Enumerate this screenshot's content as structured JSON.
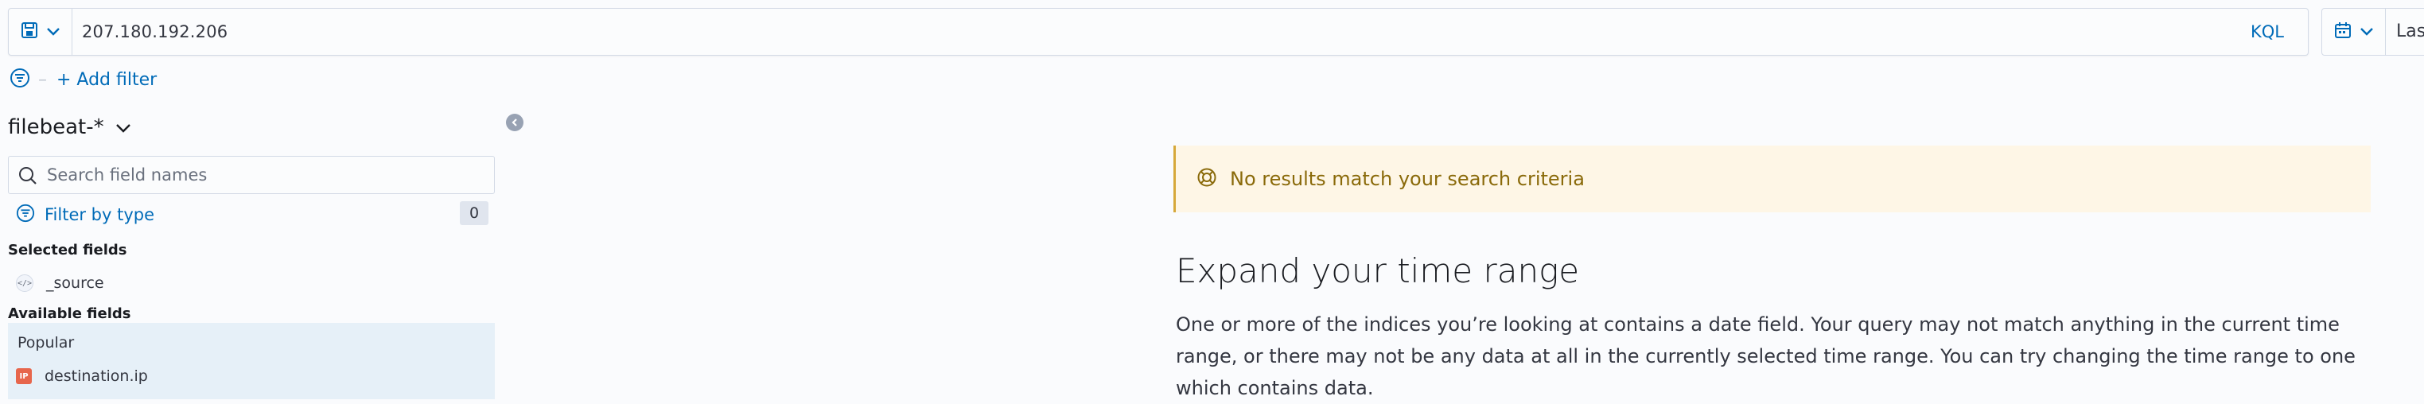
{
  "query_bar": {
    "query": "207.180.192.206",
    "language": "KQL",
    "saved_query_icon": "save-icon",
    "chevron_icon": "chevron-down-icon"
  },
  "date_picker": {
    "icon": "calendar-icon",
    "label": "Las"
  },
  "filter_bar": {
    "filter_icon": "filter-icon",
    "separator": "–",
    "add_filter_label": "+ Add filter"
  },
  "sidebar": {
    "index_pattern": "filebeat-*",
    "search_placeholder": "Search field names",
    "filter_by_type_label": "Filter by type",
    "filter_count": "0",
    "selected_fields_title": "Selected fields",
    "selected_fields": [
      {
        "name": "_source",
        "type_icon": "</>"
      }
    ],
    "available_fields_title": "Available fields",
    "popular_title": "Popular",
    "popular_fields": [
      {
        "name": "destination.ip",
        "type_icon": "IP"
      }
    ]
  },
  "main": {
    "callout_title": "No results match your search criteria",
    "expand_title": "Expand your time range",
    "expand_body": "One or more of the indices you’re looking at contains a date field. Your query may not match anything in the current time range, or there may not be any data at all in the currently selected time range. You can try changing the time range to one which contains data."
  },
  "colors": {
    "link": "#006bb8",
    "callout_bg": "#fef6e6",
    "callout_text": "#8a6a0a",
    "popular_bg": "#e6f0f8",
    "ip_badge": "#e7664c"
  }
}
